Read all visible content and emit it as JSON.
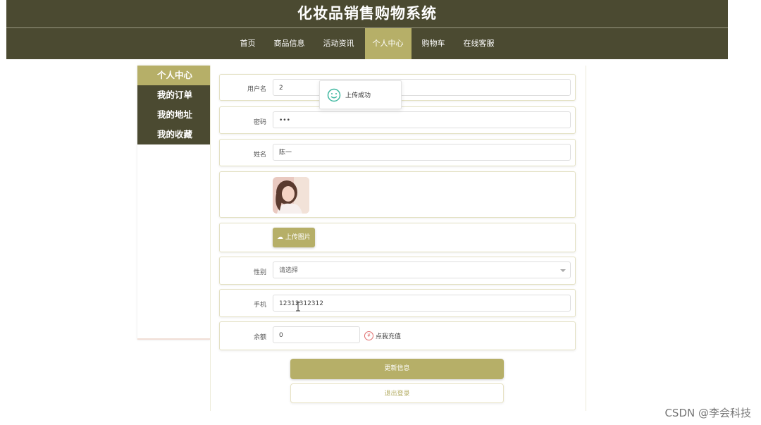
{
  "site": {
    "title": "化妆品销售购物系统"
  },
  "nav": {
    "items": [
      {
        "label": "首页",
        "active": false
      },
      {
        "label": "商品信息",
        "active": false
      },
      {
        "label": "活动资讯",
        "active": false
      },
      {
        "label": "个人中心",
        "active": true
      },
      {
        "label": "购物车",
        "active": false
      },
      {
        "label": "在线客服",
        "active": false
      }
    ]
  },
  "sidebar": {
    "items": [
      {
        "label": "个人中心",
        "active": true
      },
      {
        "label": "我的订单",
        "active": false
      },
      {
        "label": "我的地址",
        "active": false
      },
      {
        "label": "我的收藏",
        "active": false
      }
    ]
  },
  "form": {
    "username": {
      "label": "用户名",
      "value": "2"
    },
    "password": {
      "label": "密码",
      "value": "•••"
    },
    "name": {
      "label": "姓名",
      "value": "陈一"
    },
    "upload": {
      "label": "上传图片"
    },
    "gender": {
      "label": "性别",
      "placeholder": "请选择"
    },
    "phone": {
      "label": "手机",
      "value": "12312312312"
    },
    "balance": {
      "label": "余额",
      "value": "0",
      "recharge_label": "点我充值"
    }
  },
  "buttons": {
    "update": "更新信息",
    "logout": "退出登录"
  },
  "toast": {
    "message": "上传成功"
  },
  "watermark": "CSDN @李会科技",
  "colors": {
    "header_bg": "#4b4a31",
    "accent": "#b6af68",
    "success": "#3fb8a0",
    "recharge": "#e06b6b"
  }
}
